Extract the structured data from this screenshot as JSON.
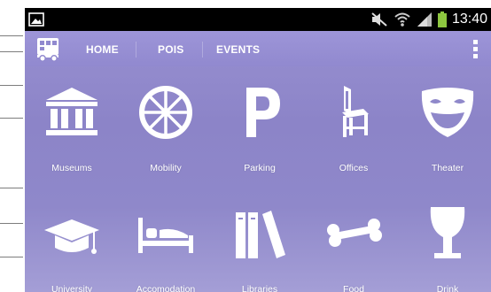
{
  "statusbar": {
    "time": "13:40",
    "icons": [
      "image-notification-icon",
      "mute-icon",
      "wifi-icon",
      "signal-icon",
      "battery-icon"
    ]
  },
  "actionbar": {
    "logo_icon": "bus-logo-icon",
    "tabs": [
      {
        "label": "HOME"
      },
      {
        "label": "POIS"
      },
      {
        "label": "EVENTS"
      }
    ],
    "overflow_icon": "overflow-menu-icon"
  },
  "grid": {
    "items": [
      {
        "label": "Museums",
        "icon": "museum-icon"
      },
      {
        "label": "Mobility",
        "icon": "wheel-icon"
      },
      {
        "label": "Parking",
        "icon": "parking-icon"
      },
      {
        "label": "Offices",
        "icon": "chair-icon"
      },
      {
        "label": "Theater",
        "icon": "theater-mask-icon"
      },
      {
        "label": "University",
        "icon": "graduation-cap-icon"
      },
      {
        "label": "Accomodation",
        "icon": "bed-icon"
      },
      {
        "label": "Libraries",
        "icon": "books-icon"
      },
      {
        "label": "Food",
        "icon": "bone-icon"
      },
      {
        "label": "Drink",
        "icon": "wine-glass-icon"
      }
    ]
  },
  "colors": {
    "background": "#8f88ca",
    "actionbar": "#9891d4",
    "statusbar": "#000000",
    "icon": "#ffffff"
  }
}
